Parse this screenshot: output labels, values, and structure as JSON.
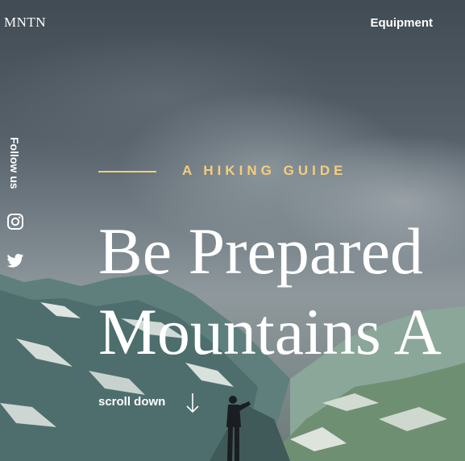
{
  "header": {
    "logo": "MNTN",
    "nav_link": "Equipment"
  },
  "social": {
    "label": "Follow us",
    "links": [
      {
        "icon": "instagram-icon"
      },
      {
        "icon": "twitter-icon"
      }
    ]
  },
  "hero": {
    "eyebrow": "A HIKING GUIDE",
    "headline_line1": "Be Prepared",
    "headline_line2": "Mountains A",
    "scroll_label": "scroll down",
    "accent_color": "#f5cd7b"
  }
}
